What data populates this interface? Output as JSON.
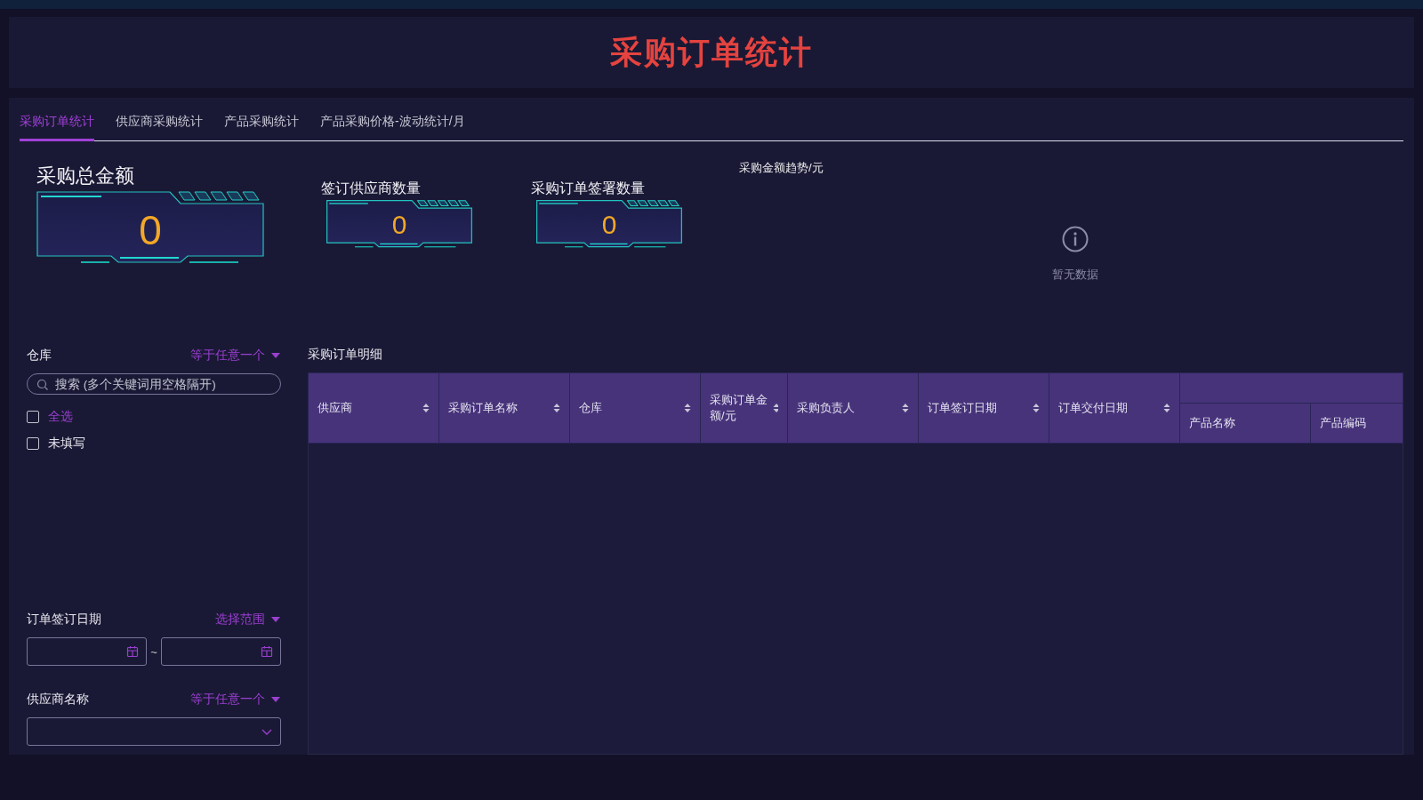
{
  "header": {
    "title": "采购订单统计"
  },
  "tabs": [
    {
      "label": "采购订单统计",
      "selected": true
    },
    {
      "label": "供应商采购统计",
      "selected": false
    },
    {
      "label": "产品采购统计",
      "selected": false
    },
    {
      "label": "产品采购价格-波动统计/月",
      "selected": false
    }
  ],
  "stats": [
    {
      "kind": "large",
      "label": "采购总金额",
      "value": "0"
    },
    {
      "kind": "small",
      "label": "签订供应商数量",
      "value": "0"
    },
    {
      "kind": "small",
      "label": "采购订单签署数量",
      "value": "0"
    }
  ],
  "trend_chart": {
    "title": "采购金额趋势/元",
    "empty_text": "暂无数据"
  },
  "filters": [
    {
      "kind": "checklist",
      "label": "仓库",
      "mode": "等于任意一个",
      "placeholder": "搜索 (多个关键词用空格隔开)",
      "options": [
        {
          "label": "全选",
          "checked": false,
          "highlighted": true
        },
        {
          "label": "未填写",
          "checked": false,
          "highlighted": false
        }
      ]
    },
    {
      "kind": "date_range",
      "label": "订单签订日期",
      "mode": "选择范围",
      "separator": "~"
    },
    {
      "kind": "select",
      "label": "供应商名称",
      "mode": "等于任意一个"
    }
  ],
  "table": {
    "title": "采购订单明细",
    "columns": [
      {
        "kind": "column",
        "label": "供应商",
        "sortable": true
      },
      {
        "kind": "column",
        "label": "采购订单名称",
        "sortable": true
      },
      {
        "kind": "column",
        "label": "仓库",
        "sortable": true
      },
      {
        "kind": "column",
        "label": "采购订单金额/元",
        "sortable": true
      },
      {
        "kind": "column",
        "label": "采购负责人",
        "sortable": true
      },
      {
        "kind": "column",
        "label": "订单签订日期",
        "sortable": true
      },
      {
        "kind": "column",
        "label": "订单交付日期",
        "sortable": true
      },
      {
        "kind": "group",
        "children": [
          {
            "label": "产品名称",
            "sortable": false
          },
          {
            "label": "产品编码",
            "sortable": false
          }
        ]
      }
    ]
  }
}
